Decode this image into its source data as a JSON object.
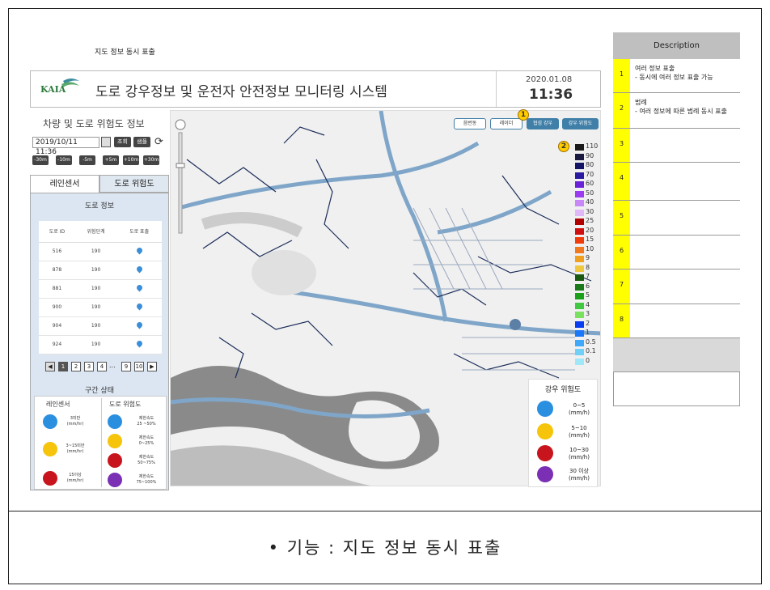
{
  "top_label": "지도 정보 동시 표출",
  "header": {
    "logo_text": "KAIA",
    "title": "도로 강우정보 및 운전자 안전정보 모니터링 시스템",
    "date": "2020.01.08",
    "time": "11:36"
  },
  "left_panel": {
    "title": "차량 및 도로 위험도 정보",
    "datetime_value": "2019/10/11 11:36",
    "query_button": "조회",
    "sample_button": "샘플",
    "offsets": [
      "-30m",
      "-10m",
      "-5m",
      "+5m",
      "+10m",
      "+30m"
    ],
    "tabs": [
      "레인센서",
      "도로 위험도"
    ],
    "road_info_title": "도로 정보",
    "table_headers": [
      "도로 ID",
      "위험단계",
      "도로 표출"
    ],
    "rows": [
      {
        "id": "516",
        "level": "190"
      },
      {
        "id": "878",
        "level": "190"
      },
      {
        "id": "881",
        "level": "190"
      },
      {
        "id": "900",
        "level": "190"
      },
      {
        "id": "904",
        "level": "190"
      },
      {
        "id": "924",
        "level": "190"
      }
    ],
    "pager": [
      "1",
      "2",
      "3",
      "4",
      "...",
      "9",
      "10"
    ],
    "section_status_title": "구간 상태",
    "status_cols": [
      "레인센서",
      "도로 위험도"
    ],
    "rain_items": [
      {
        "label": "3미만\n(mm/hr)",
        "color": "#2b8fe0"
      },
      {
        "label": "3~15미만\n(mm/hr)",
        "color": "#f5c40b"
      },
      {
        "label": "15이상\n(mm/hr)",
        "color": "#c8141c"
      }
    ],
    "risk_items": [
      {
        "label": "제한속도\n25 ~50%",
        "color": "#2b8fe0"
      },
      {
        "label": "제한속도\n0~25%",
        "color": "#f5c40b"
      },
      {
        "label": "제한속도\n50~75%",
        "color": "#c8141c"
      },
      {
        "label": "제한속도\n75~100%",
        "color": "#7a2fb5"
      }
    ]
  },
  "map": {
    "buttons": [
      "음번동",
      "레이더",
      "협섬 강우",
      "강우 위험도"
    ],
    "badge_1": "1",
    "badge_2": "2",
    "scale_labels": [
      "110",
      "90",
      "80",
      "70",
      "60",
      "50",
      "40",
      "30",
      "25",
      "20",
      "15",
      "10",
      "9",
      "8",
      "7",
      "6",
      "5",
      "4",
      "3",
      "2",
      "1",
      "0.5",
      "0.1",
      "0"
    ],
    "scale_colors": [
      "#1a1a1a",
      "#1a1a40",
      "#141466",
      "#2a1aa0",
      "#6a22d8",
      "#9a3cf0",
      "#c888f8",
      "#e0b8f8",
      "#b00000",
      "#d01010",
      "#f03c0a",
      "#f0781e",
      "#f0a01e",
      "#f0c840",
      "#1a5a10",
      "#1a7a1a",
      "#1aa01a",
      "#40c840",
      "#7ae060",
      "#0a3cf0",
      "#1a78f8",
      "#40a8f8",
      "#70d0f8",
      "#a0e8f8"
    ],
    "rain_legend_title": "강우 위험도",
    "rain_legend": [
      {
        "label": "0~5\n(mm/h)",
        "color": "#2b8fe0"
      },
      {
        "label": "5~10\n(mm/h)",
        "color": "#f5c40b"
      },
      {
        "label": "10~30\n(mm/h)",
        "color": "#c8141c"
      },
      {
        "label": "30 이상\n(mm/h)",
        "color": "#7a2fb5"
      }
    ]
  },
  "description": {
    "header": "Description",
    "rows": [
      {
        "num": "1",
        "text": "여러 정보 표출\n- 동시에 여러 정보 표출 가능"
      },
      {
        "num": "2",
        "text": "범례\n- 여러 정보에 따른 범례 동시 표출"
      },
      {
        "num": "3",
        "text": ""
      },
      {
        "num": "4",
        "text": ""
      },
      {
        "num": "5",
        "text": ""
      },
      {
        "num": "6",
        "text": ""
      },
      {
        "num": "7",
        "text": ""
      },
      {
        "num": "8",
        "text": ""
      }
    ]
  },
  "caption": "• 기능 : 지도 정보 동시 표출"
}
